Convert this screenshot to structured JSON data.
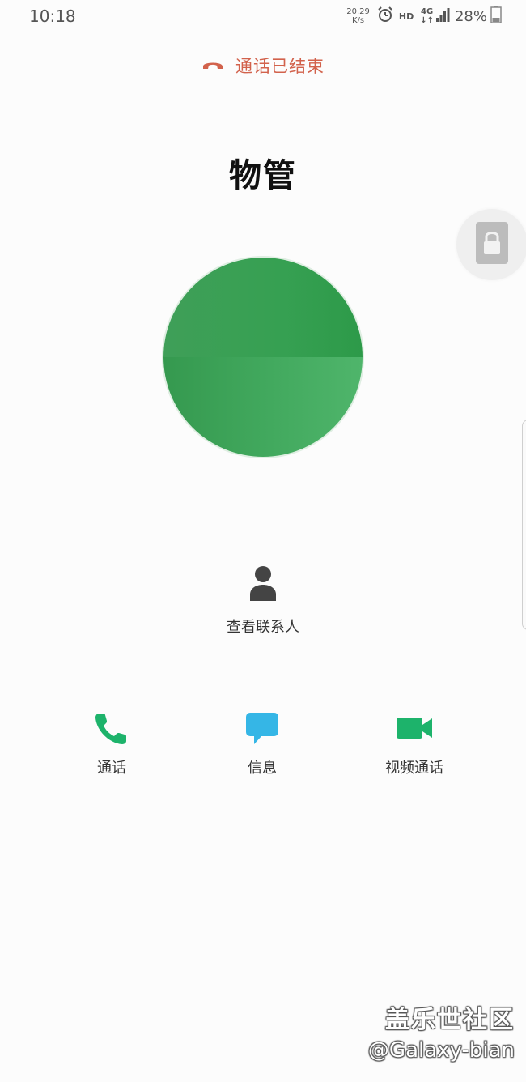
{
  "status_bar": {
    "time": "10:18",
    "net_speed_value": "20.29",
    "net_speed_unit": "K/s",
    "hd": "HD",
    "network": "4G",
    "network_arrows": "↓↑",
    "battery": "28%"
  },
  "call": {
    "status_text": "通话已结束",
    "contact_name": "物管"
  },
  "view_contact": {
    "label": "查看联系人"
  },
  "actions": {
    "call_label": "通话",
    "message_label": "信息",
    "video_label": "视频通话"
  },
  "watermark": {
    "line1": "盖乐世社区",
    "line2": "@Galaxy-bian"
  },
  "colors": {
    "call_ended": "#d2624c",
    "avatar_green": "#36a052",
    "call_icon": "#1db36b",
    "message_icon": "#35b6e6",
    "video_icon": "#1db36b"
  }
}
